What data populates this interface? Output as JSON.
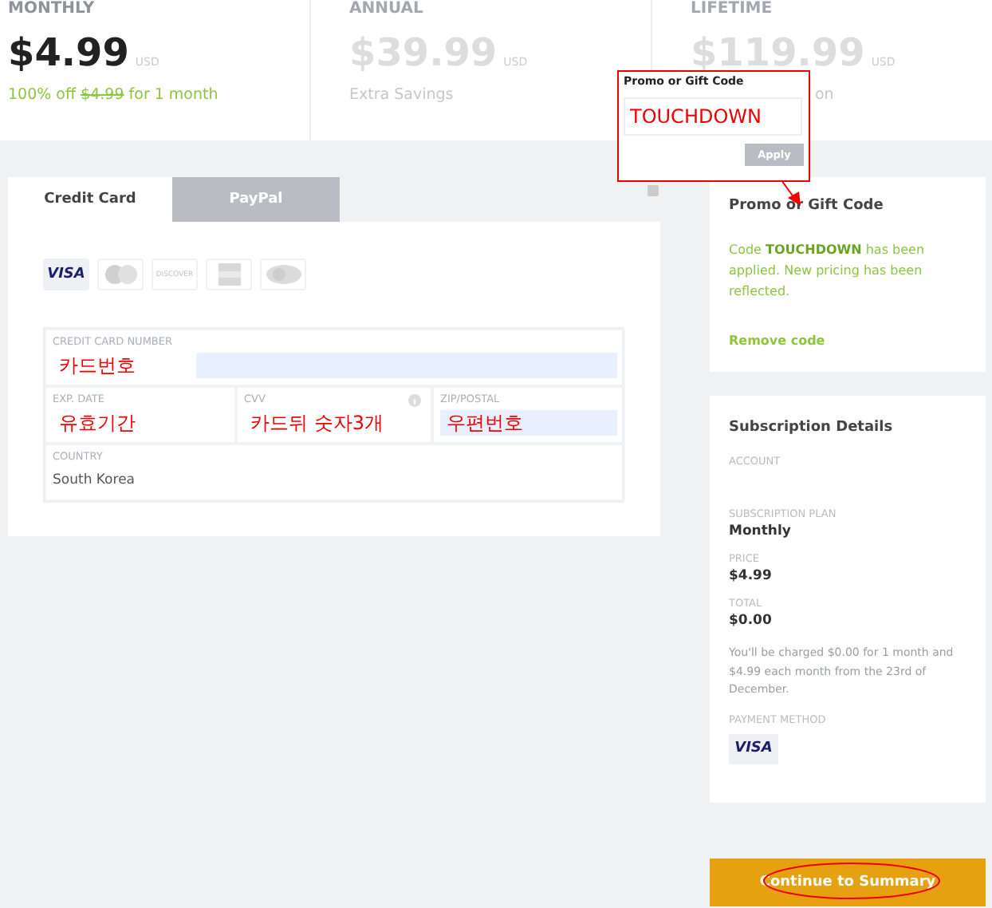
{
  "plans": [
    {
      "title": "MONTHLY",
      "price": "$4.99",
      "currency": "USD",
      "selected": true,
      "note": {
        "kind": "discount",
        "prefix": "100% off",
        "struck": "$4.99",
        "suffix": "for 1 month"
      }
    },
    {
      "title": "ANNUAL",
      "price": "$39.99",
      "currency": "USD",
      "selected": false,
      "note": {
        "kind": "plain",
        "text": "Extra Savings"
      }
    },
    {
      "title": "LIFETIME",
      "price": "$119.99",
      "currency": "USD",
      "selected": false,
      "note": {
        "kind": "covered",
        "text": "on"
      }
    }
  ],
  "payment": {
    "tabs": [
      {
        "label": "Credit Card",
        "selected": true
      },
      {
        "label": "PayPal",
        "selected": false
      }
    ],
    "brands": [
      {
        "kind": "visa",
        "label": "VISA",
        "selected": true
      },
      {
        "kind": "mastercard",
        "selected": false
      },
      {
        "kind": "discover",
        "label": "DISCOVER",
        "selected": false
      },
      {
        "kind": "amex",
        "selected": false
      },
      {
        "kind": "diners",
        "selected": false
      }
    ],
    "fields": [
      {
        "label": "CREDIT CARD NUMBER",
        "value": "카드번호",
        "autofilled": true,
        "info": false
      },
      {
        "label": "EXP. DATE",
        "value": "유효기간",
        "autofilled": false,
        "info": false
      },
      {
        "label": "CVV",
        "value": "카드뒤 숫자3개",
        "autofilled": false,
        "info": true
      },
      {
        "label": "ZIP/POSTAL",
        "value": "우편번호",
        "autofilled": true,
        "info": false
      },
      {
        "label": "COUNTRY",
        "value": "South Korea",
        "autofilled": false,
        "info": false
      }
    ]
  },
  "promo": {
    "title": "Promo or Gift Code",
    "message_parts": [
      "Code",
      "TOUCHDOWN",
      "has been applied. New pricing has been reflected."
    ],
    "remove": "Remove code"
  },
  "subscription": {
    "title": "Subscription Details",
    "rows": [
      {
        "label": "ACCOUNT",
        "value": ""
      },
      {
        "label": "SUBSCRIPTION PLAN",
        "value": "Monthly"
      },
      {
        "label": "PRICE",
        "value": "$4.99"
      },
      {
        "label": "TOTAL",
        "value": "$0.00"
      }
    ],
    "note": "You'll be charged $0.00 for 1 month and $4.99 each month from the 23rd of December.",
    "method_label": "PAYMENT METHOD",
    "method": "VISA"
  },
  "continue": "Continue to Summary",
  "popup": {
    "title": "Promo or Gift Code",
    "value": "TOUCHDOWN",
    "button": "Apply"
  }
}
